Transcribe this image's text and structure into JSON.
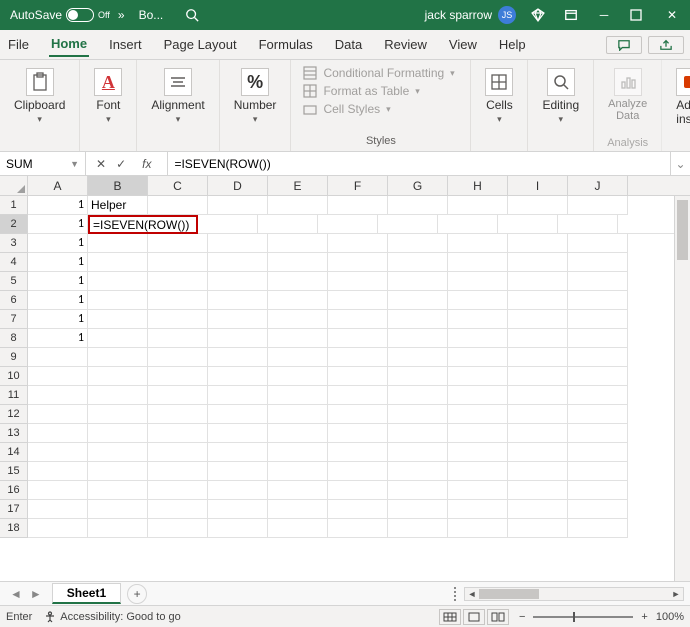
{
  "titlebar": {
    "autosave_label": "AutoSave",
    "autosave_state": "Off",
    "doc_name": "Bo...",
    "user_name": "jack sparrow",
    "user_initials": "JS"
  },
  "tabs": {
    "items": [
      "File",
      "Home",
      "Insert",
      "Page Layout",
      "Formulas",
      "Data",
      "Review",
      "View",
      "Help"
    ],
    "active": "Home"
  },
  "ribbon": {
    "clipboard": "Clipboard",
    "font": "Font",
    "alignment": "Alignment",
    "number": "Number",
    "styles_label": "Styles",
    "cond_format": "Conditional Formatting",
    "format_table": "Format as Table",
    "cell_styles": "Cell Styles",
    "cells": "Cells",
    "editing": "Editing",
    "analysis": "Analysis",
    "analyze_data": "Analyze Data",
    "addins": "Add-ins"
  },
  "formula_bar": {
    "name_box": "SUM",
    "formula": "=ISEVEN(ROW())"
  },
  "columns": [
    "A",
    "B",
    "C",
    "D",
    "E",
    "F",
    "G",
    "H",
    "I",
    "J"
  ],
  "rows": [
    1,
    2,
    3,
    4,
    5,
    6,
    7,
    8,
    9,
    10,
    11,
    12,
    13,
    14,
    15,
    16,
    17,
    18
  ],
  "cells": {
    "A1": "1",
    "B1": "Helper",
    "A2": "1",
    "B2_editing": "=ISEVEN(ROW())",
    "A3": "1",
    "A4": "1",
    "A5": "1",
    "A6": "1",
    "A7": "1",
    "A8": "1"
  },
  "active_cell": {
    "row": 2,
    "col": "B"
  },
  "sheet": {
    "name": "Sheet1"
  },
  "status": {
    "mode": "Enter",
    "accessibility": "Accessibility: Good to go",
    "zoom": "100%"
  }
}
